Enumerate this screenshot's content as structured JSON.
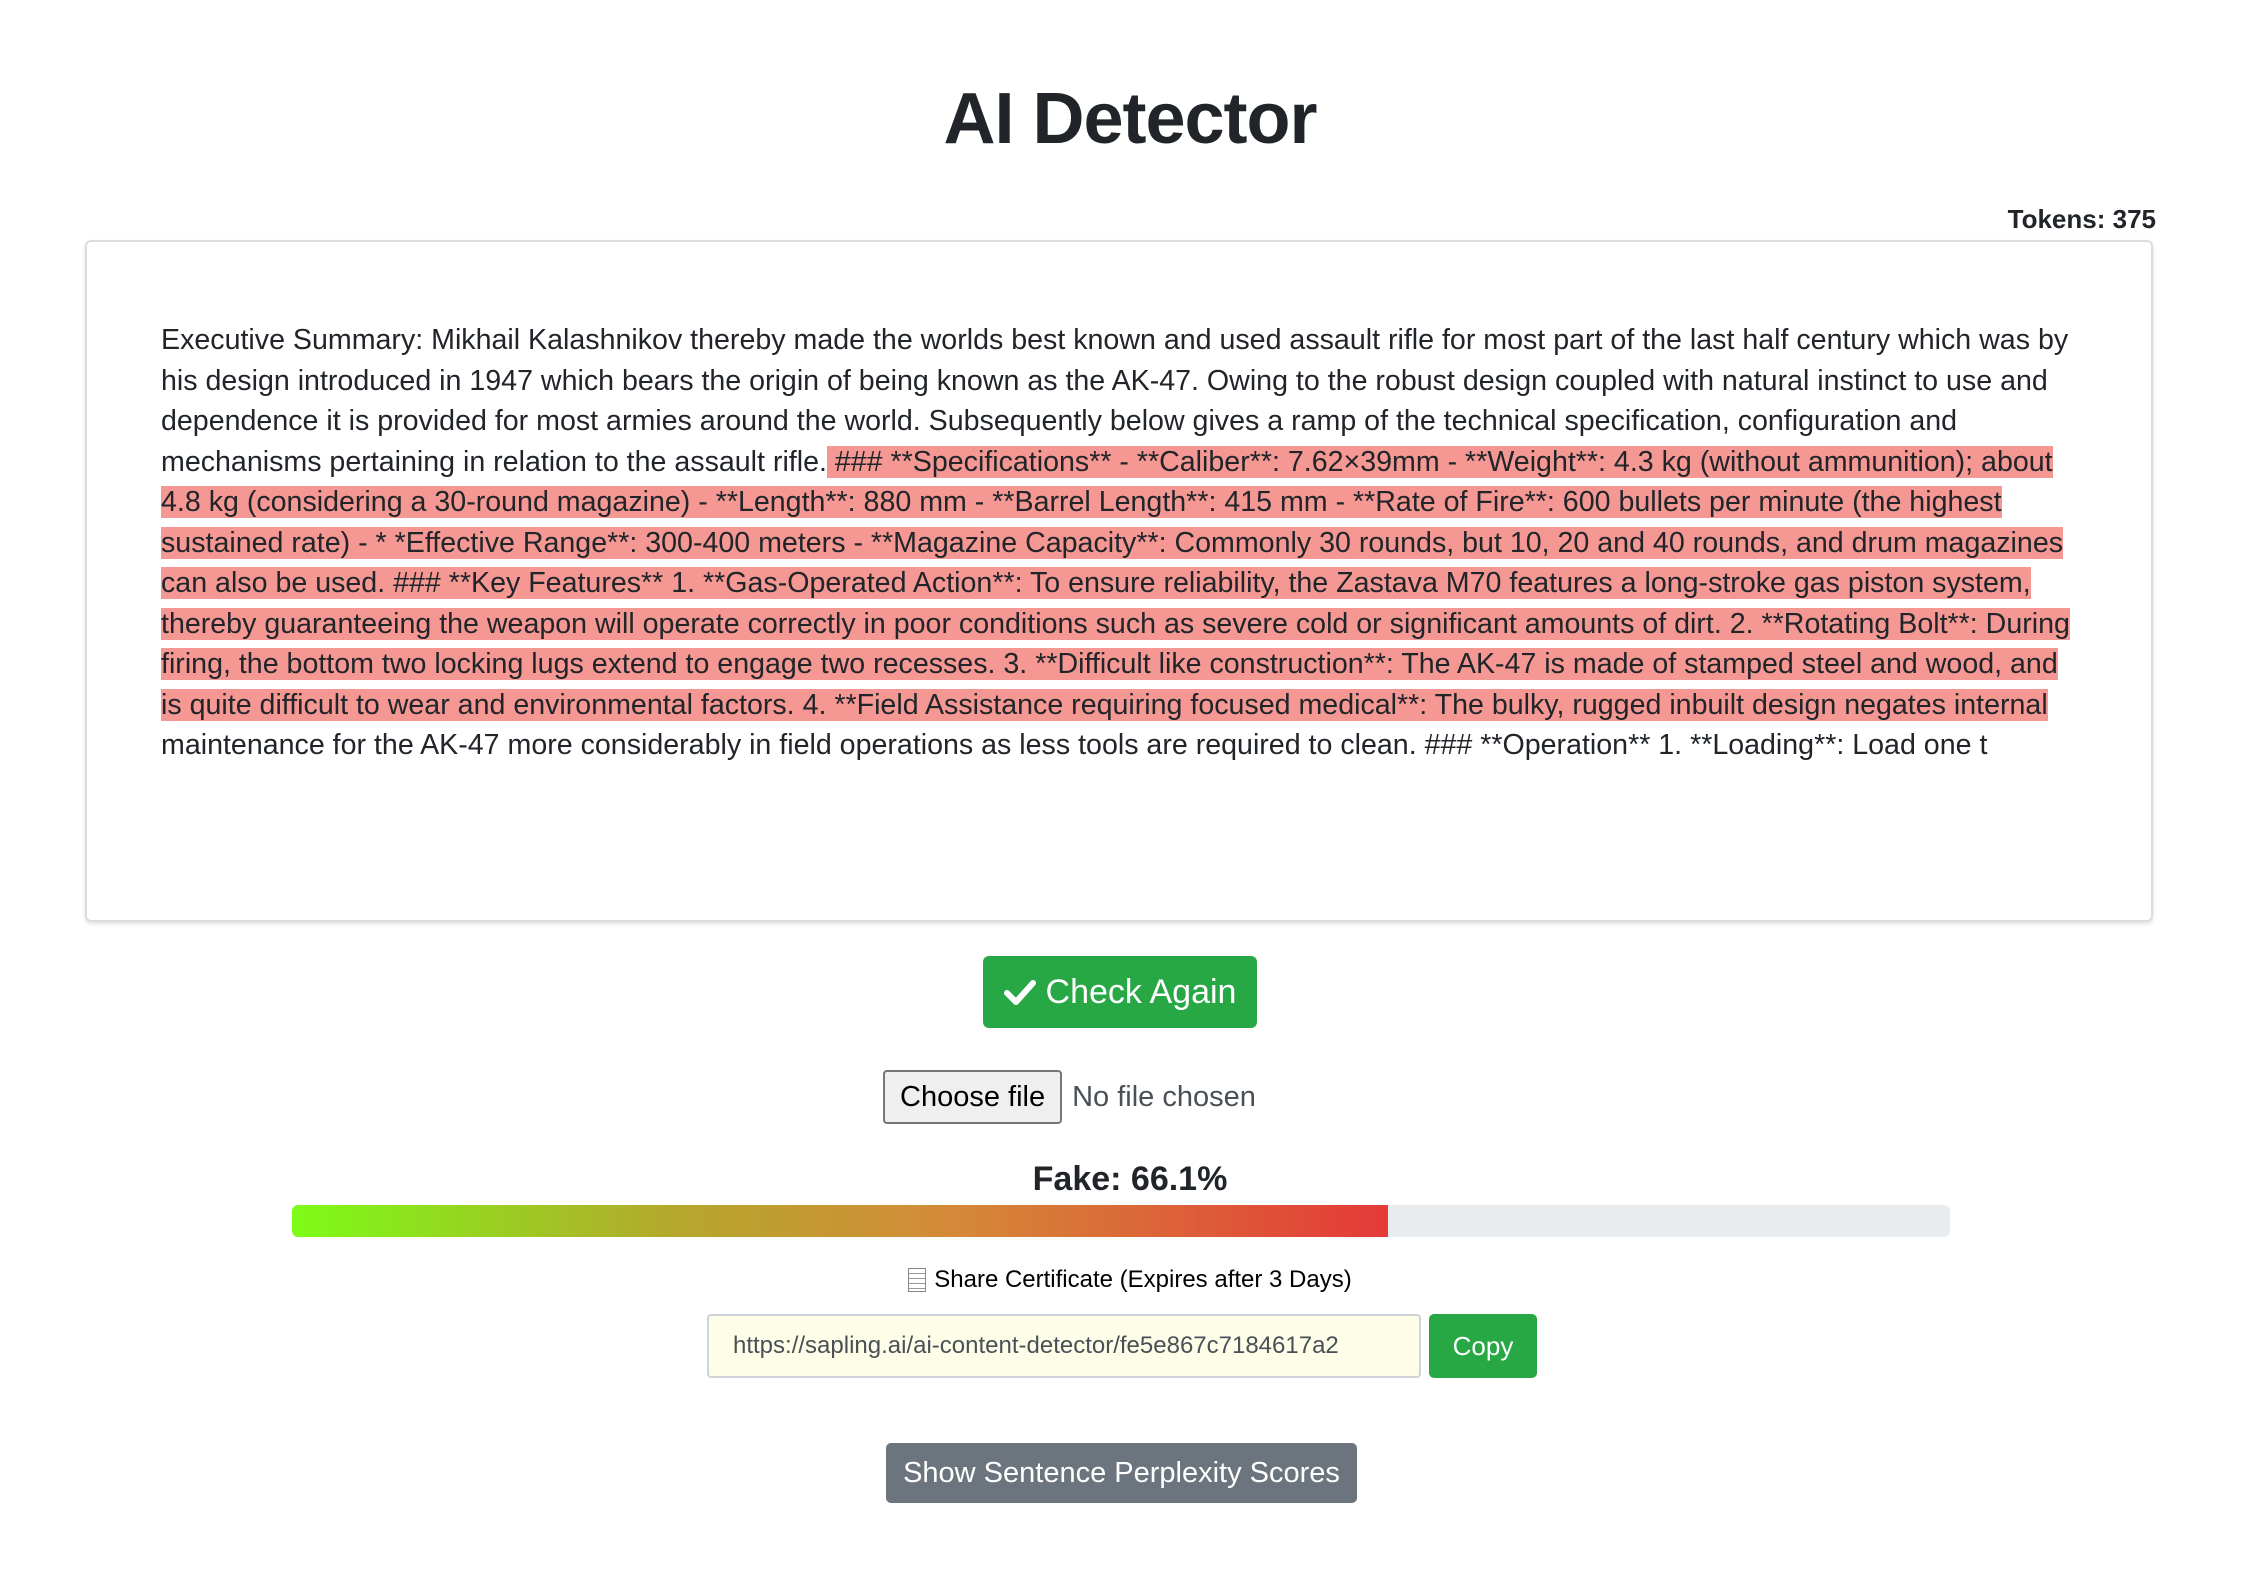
{
  "header": {
    "title": "AI Detector",
    "tokens": "Tokens: 375"
  },
  "editor": {
    "text_before": "Executive Summary: Mikhail Kalashnikov thereby made the worlds best known and used assault rifle for most part of the last half century which was by his design introduced in 1947 which bears the origin of being known as the AK-47. Owing to the robust design coupled with natural instinct to use and dependence it is provided for most armies around the world. Subsequently below gives a ramp of the technical specification, configuration and mechanisms pertaining in relation to the assault rifle.",
    "text_highlighted": " ### **Specifications** - **Caliber**: 7.62×39mm - **Weight**: 4.3 kg (without ammunition); about 4.8 kg (considering a 30-round magazine) - **Length**: 880 mm - **Barrel Length**: 415 mm - **Rate of Fire**: 600 bullets per minute (the highest sustained rate) - * *Effective Range**: 300-400 meters - **Magazine Capacity**: Commonly 30 rounds, but 10, 20 and 40 rounds, and drum magazines can also be used. ### **Key Features** 1. **Gas-Operated Action**: To ensure reliability, the Zastava M70 features a long-stroke gas piston system, thereby guaranteeing the weapon will operate correctly in poor conditions such as severe cold or significant amounts of dirt. 2. **Rotating Bolt**: During firing, the bottom two locking lugs extend to engage two recesses. 3. **Difficult like construction**: The AK-47 is made of stamped steel and wood, and is quite difficult to wear and environmental factors. 4. **Field Assistance requiring focused medical**: The bulky, rugged inbuilt design negates internal ",
    "text_after": "maintenance for the AK-47 more considerably in field operations as less tools are required to clean. ### **Operation** 1. **Loading**: Load one t",
    "highlight_color": "#f59893"
  },
  "actions": {
    "check_again_label": "Check Again",
    "check_icon": "check-icon"
  },
  "file_input": {
    "button_label": "Choose file",
    "status": "No file chosen"
  },
  "result": {
    "label": "Fake: 66.1%",
    "fake_fraction": 0.661
  },
  "share": {
    "icon": "document-icon",
    "label": "Share Certificate (Expires after 3 Days)",
    "url": "https://sapling.ai/ai-content-detector/fe5e867c7184617a2",
    "copy_label": "Copy"
  },
  "perplexity": {
    "button_label": "Show Sentence Perplexity Scores"
  },
  "colors": {
    "primary_green": "#28a745",
    "secondary_gray": "#6c757d",
    "bar_start": "#7cfc16",
    "bar_end": "#e43a38"
  }
}
